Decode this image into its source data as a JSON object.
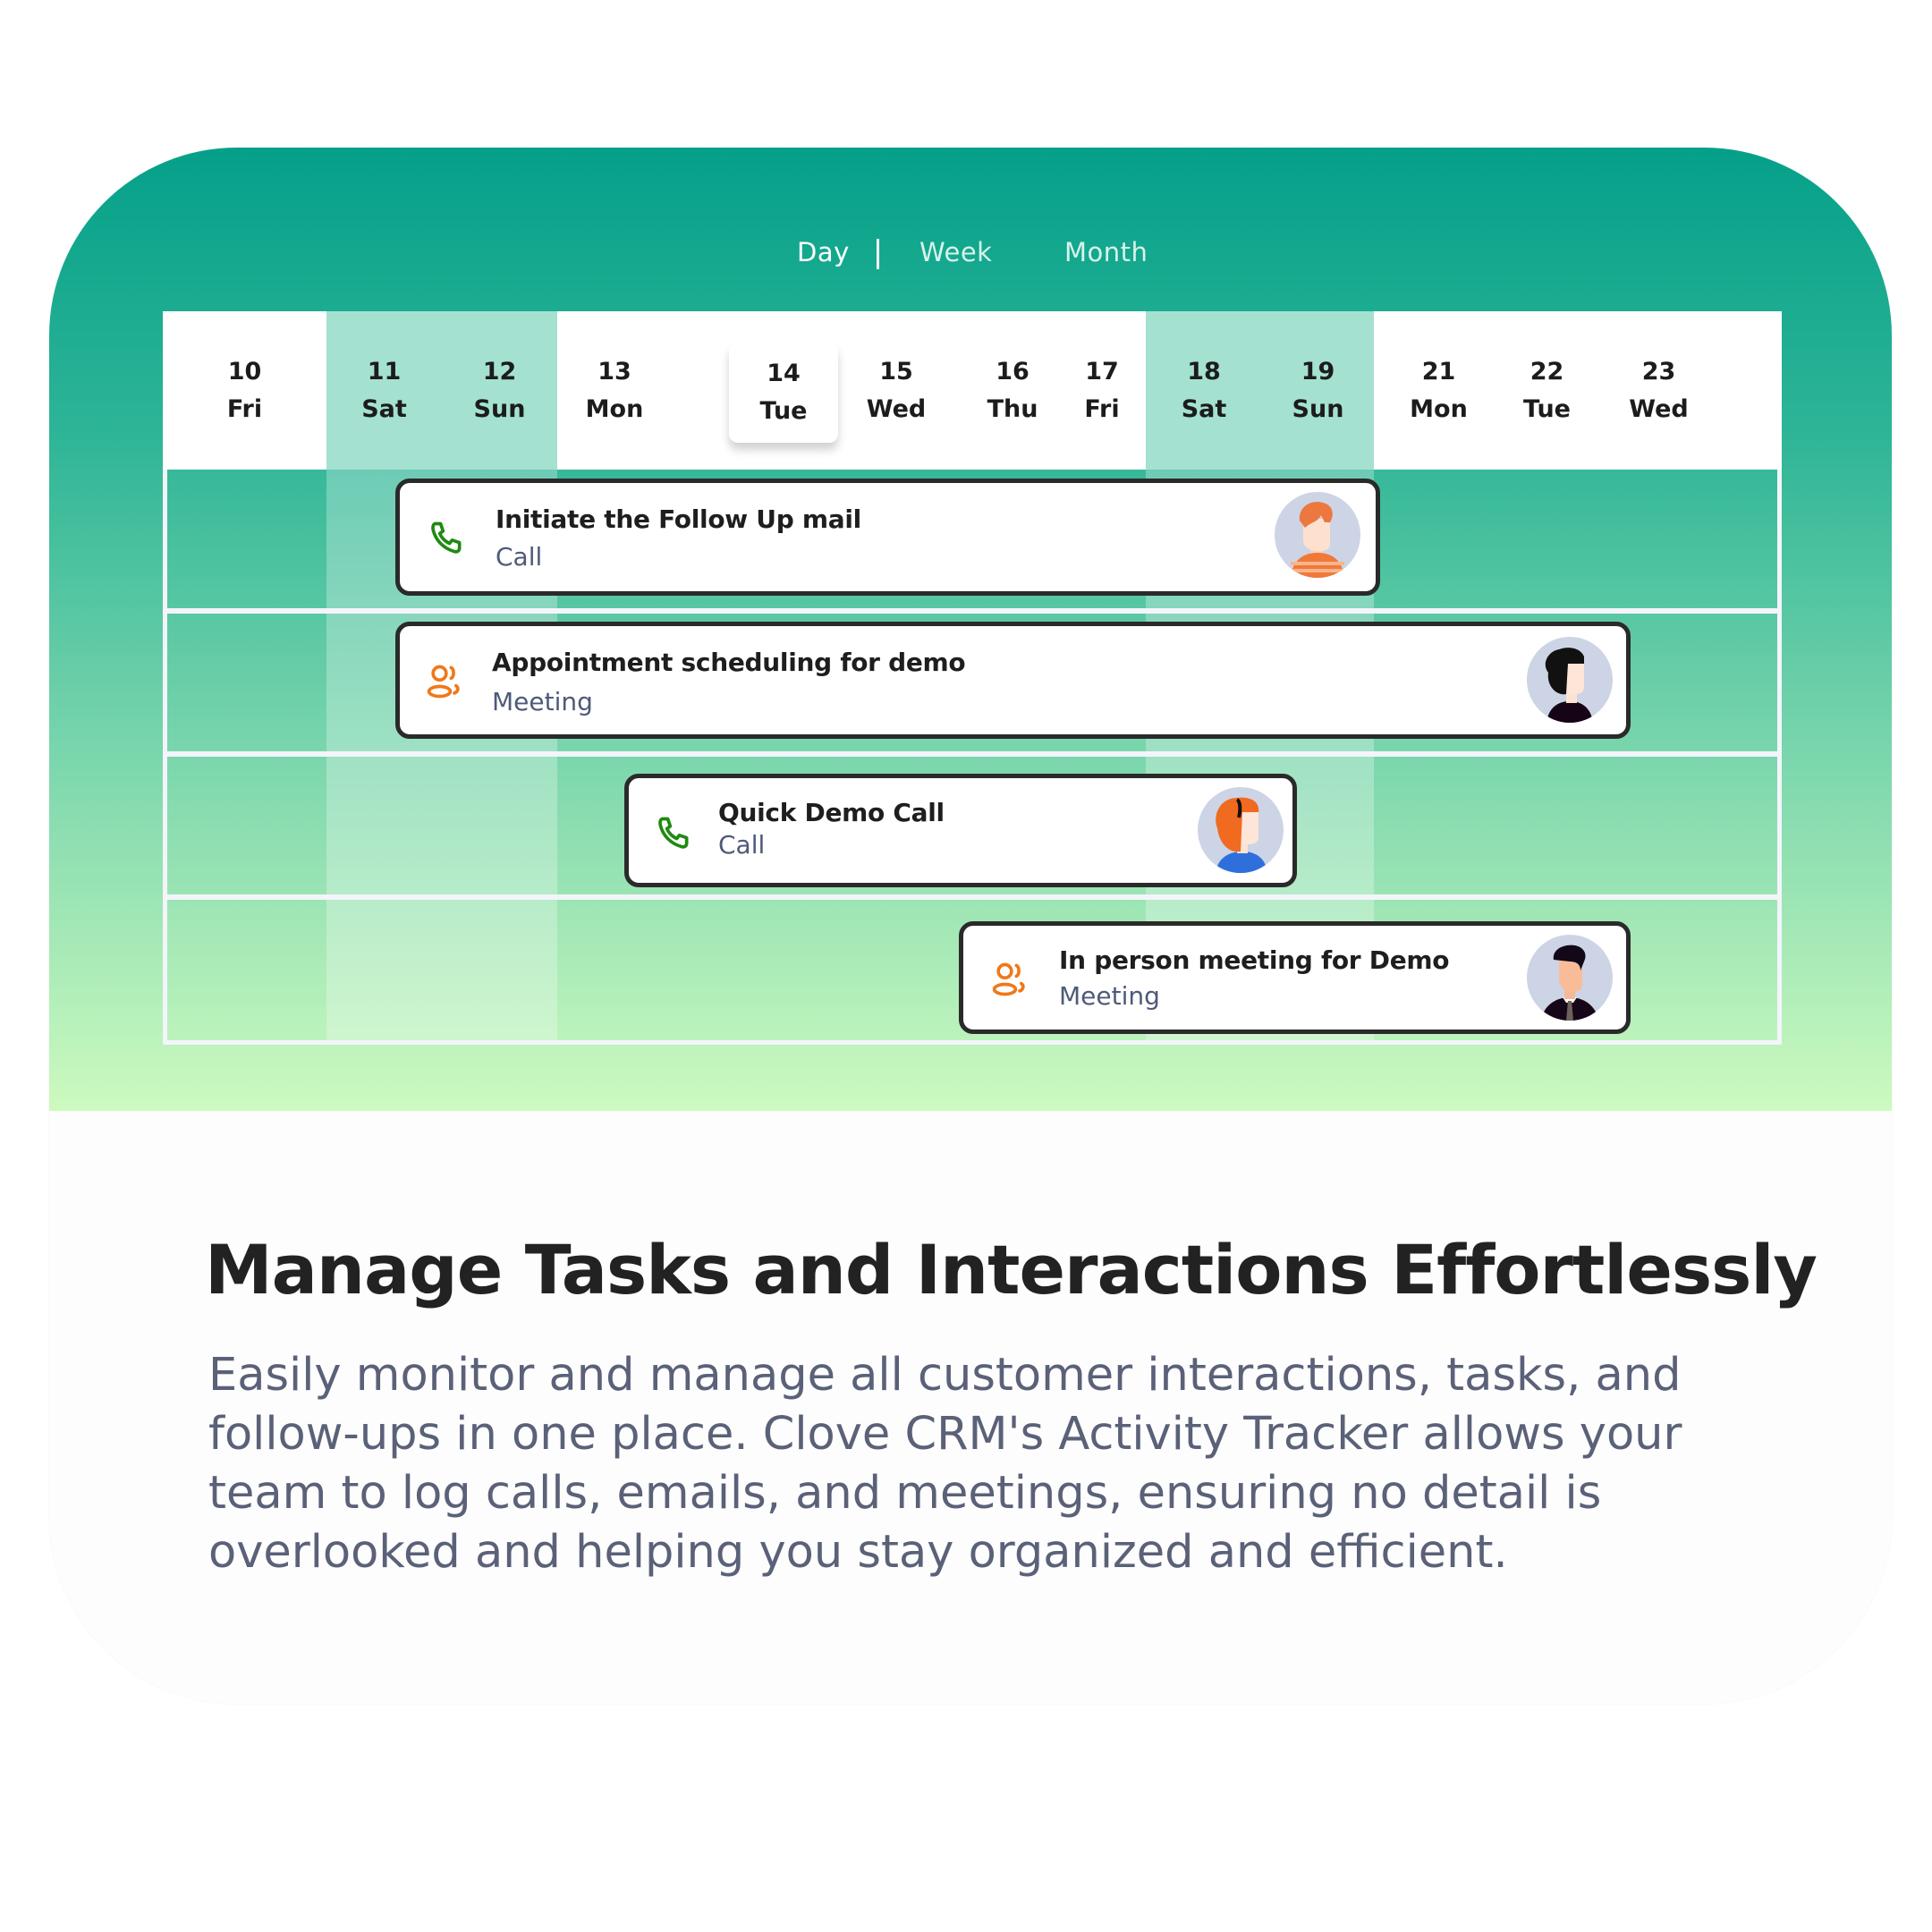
{
  "view_tabs": {
    "day": "Day",
    "week": "Week",
    "month": "Month",
    "active": "Day"
  },
  "calendar": {
    "days": [
      {
        "num": "10",
        "dow": "Fri",
        "weekend": false
      },
      {
        "num": "11",
        "dow": "Sat",
        "weekend": true
      },
      {
        "num": "12",
        "dow": "Sun",
        "weekend": true
      },
      {
        "num": "13",
        "dow": "Mon",
        "weekend": false
      },
      {
        "num": "14",
        "dow": "Tue",
        "weekend": false,
        "today": true
      },
      {
        "num": "15",
        "dow": "Wed",
        "weekend": false
      },
      {
        "num": "16",
        "dow": "Thu",
        "weekend": false
      },
      {
        "num": "17",
        "dow": "Fri",
        "weekend": false
      },
      {
        "num": "18",
        "dow": "Sat",
        "weekend": true
      },
      {
        "num": "19",
        "dow": "Sun",
        "weekend": true
      },
      {
        "num": "21",
        "dow": "Mon",
        "weekend": false
      },
      {
        "num": "22",
        "dow": "Tue",
        "weekend": false
      },
      {
        "num": "23",
        "dow": "Wed",
        "weekend": false
      }
    ],
    "selected_day": "14 Tue",
    "events": [
      {
        "title": "Initiate the Follow Up mail",
        "type": "Call",
        "icon": "phone-icon",
        "avatar": "man-orange-hair-striped-shirt",
        "start": "11 Sat",
        "end": "19 Sun"
      },
      {
        "title": "Appointment scheduling for demo",
        "type": "Meeting",
        "icon": "users-icon",
        "avatar": "woman-dark-curly-hair",
        "start": "11 Sat",
        "end": "22 Tue"
      },
      {
        "title": "Quick Demo Call",
        "type": "Call",
        "icon": "phone-icon",
        "avatar": "woman-red-hair-headset",
        "start": "13 Mon",
        "end": "18 Sat"
      },
      {
        "title": "In person meeting for Demo",
        "type": "Meeting",
        "icon": "users-icon",
        "avatar": "man-suit-tie",
        "start": "16 Thu",
        "end": "22 Tue"
      }
    ]
  },
  "colors": {
    "brand_teal": "#05a08a",
    "light_green": "#cdfabf",
    "call_icon": "#1f8a10",
    "meeting_icon": "#f07818",
    "subtext": "#4e5a78"
  },
  "content": {
    "heading": "Manage Tasks and Interactions Effortlessly",
    "description_lines": [
      "Easily monitor and manage all customer interactions, tasks, and",
      "follow-ups in one place. Clove CRM's Activity Tracker allows your",
      "team to log calls, emails, and meetings, ensuring no detail is",
      "overlooked and helping you stay organized and efficient."
    ]
  }
}
